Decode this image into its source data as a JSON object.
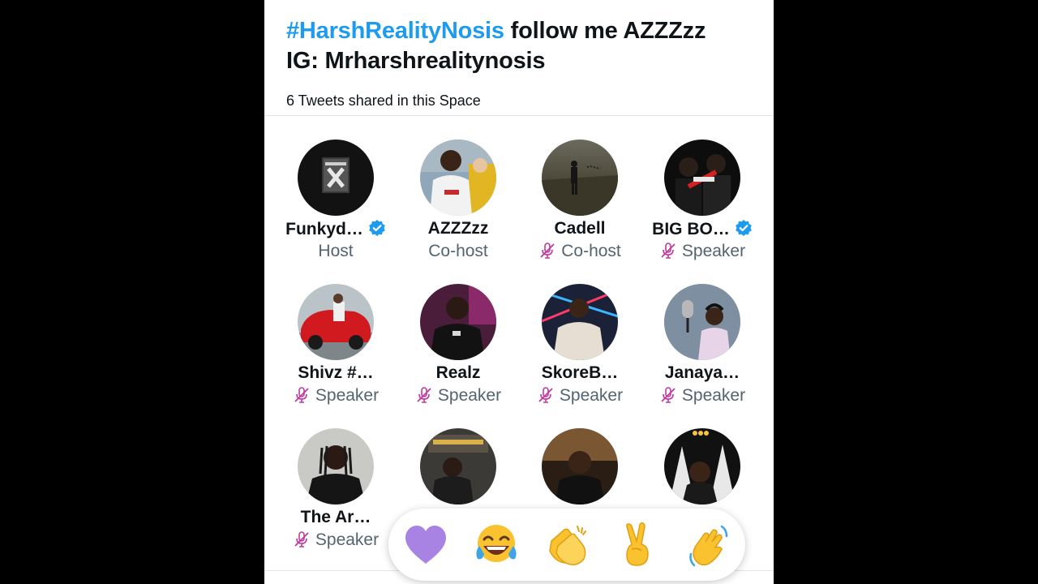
{
  "space": {
    "title_hashtag": "#HarshRealityNosis",
    "title_rest": " follow me AZZZzz",
    "title_line2": "IG: Mrharshrealitynosis",
    "tweets_shared": "6 Tweets shared in this Space"
  },
  "participants": [
    {
      "name": "Funkyd…",
      "role": "Host",
      "verified": true,
      "muted": false
    },
    {
      "name": "AZZZzz",
      "role": "Co-host",
      "verified": false,
      "muted": false
    },
    {
      "name": "Cadell",
      "role": "Co-host",
      "verified": false,
      "muted": true
    },
    {
      "name": "BIG BO…",
      "role": "Speaker",
      "verified": true,
      "muted": true
    },
    {
      "name": "Shivz #…",
      "role": "Speaker",
      "verified": false,
      "muted": true
    },
    {
      "name": "Realz",
      "role": "Speaker",
      "verified": false,
      "muted": true
    },
    {
      "name": "SkoreB…",
      "role": "Speaker",
      "verified": false,
      "muted": true
    },
    {
      "name": "Janaya…",
      "role": "Speaker",
      "verified": false,
      "muted": true
    },
    {
      "name": "The Ar…",
      "role": "Speaker",
      "verified": false,
      "muted": true
    },
    {
      "name": "",
      "role": "",
      "verified": false,
      "muted": false
    },
    {
      "name": "",
      "role": "",
      "verified": false,
      "muted": false
    },
    {
      "name": "",
      "role": "",
      "verified": false,
      "muted": false
    }
  ],
  "reactions": [
    "purple-heart-icon",
    "tears-of-joy-icon",
    "clapping-hands-icon",
    "victory-hand-icon",
    "waving-hand-icon"
  ],
  "colors": {
    "accent": "#1d9bf0",
    "text": "#0f1419",
    "secondary_text": "#536471",
    "muted_mic": "#c0399f",
    "background": "#ffffff",
    "letterbox": "#000000"
  }
}
